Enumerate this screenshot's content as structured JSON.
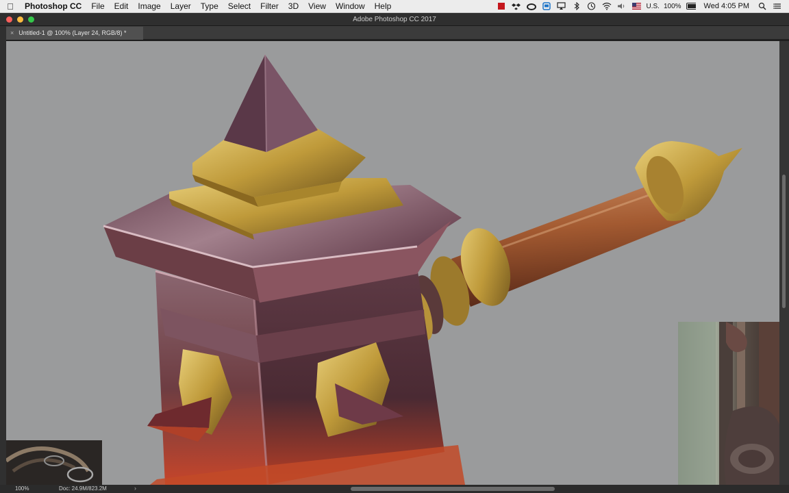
{
  "menubar": {
    "app_name": "Photoshop CC",
    "items": [
      "File",
      "Edit",
      "Image",
      "Layer",
      "Type",
      "Select",
      "Filter",
      "3D",
      "View",
      "Window",
      "Help"
    ],
    "status_icons": [
      "adobe-icon",
      "dropbox-icon",
      "creative-cloud-icon",
      "screen-sharing-icon",
      "airplay-icon",
      "bluetooth-icon",
      "time-machine-icon",
      "wifi-icon",
      "volume-icon",
      "flag-icon",
      "battery-icon",
      "search-icon",
      "notification-center-icon"
    ],
    "input_source": "U.S.",
    "battery_percent": "100%",
    "clock": "Wed 4:05 PM"
  },
  "window": {
    "title": "Adobe Photoshop CC 2017"
  },
  "document": {
    "tab_close": "×",
    "tab_title": "Untitled-1 @ 100% (Layer 24, RGB/8) *"
  },
  "statusbar": {
    "zoom": "100%",
    "doc_size": "Doc: 24.9M/823.2M",
    "arrow": "›"
  },
  "colors": {
    "canvas_bg": "#9a9b9c",
    "metal_purple": "#5c3a45",
    "gold": "#c8a43c",
    "copper": "#a45a32"
  }
}
